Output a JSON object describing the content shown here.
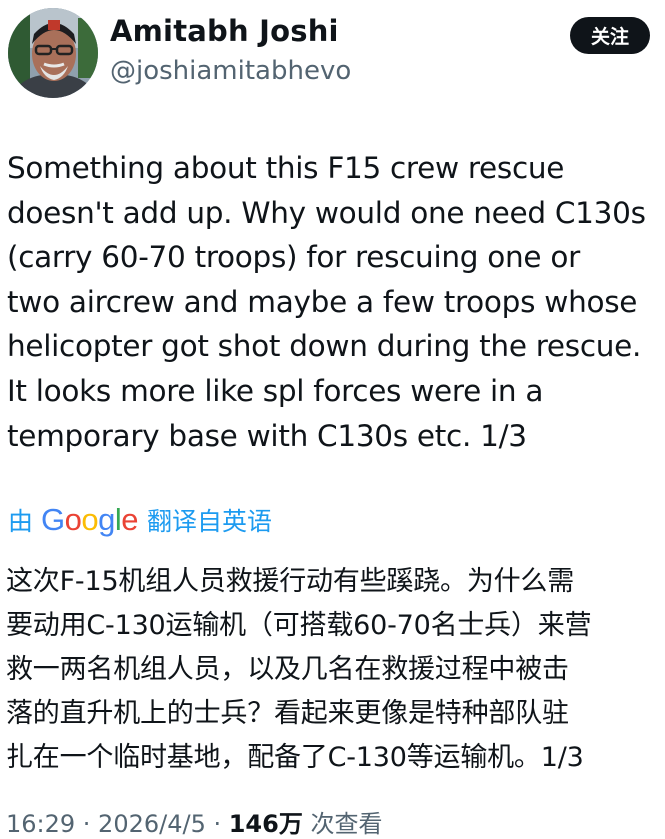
{
  "author": {
    "name": "Amitabh Joshi",
    "handle": "@joshiamitabhevo",
    "follow_label": "关注"
  },
  "tweet": {
    "lines": [
      "Something about this F15 crew rescue",
      "doesn't add up. Why would one need C130s",
      "(carry 60-70 troops) for rescuing one or",
      "two aircrew and maybe a few troops whose",
      "helicopter got shot down during the rescue.",
      "It looks more like spl forces were in a",
      "temporary base with C130s etc. 1/3"
    ]
  },
  "translation_bar": {
    "by_label": "由",
    "logo": {
      "letters": [
        "G",
        "o",
        "o",
        "g",
        "l",
        "e"
      ],
      "colors": [
        "#4285F4",
        "#EA4335",
        "#FBBC05",
        "#4285F4",
        "#34A853",
        "#EA4335"
      ]
    },
    "from_label": "翻译自英语"
  },
  "translation": {
    "lines": [
      "这次F-15机组人员救援行动有些蹊跷。为什么需",
      "要动用C-130运输机（可搭载60-70名士兵）来营",
      "救一两名机组人员，以及几名在救援过程中被击",
      "落的直升机上的士兵？看起来更像是特种部队驻",
      "扎在一个临时基地，配备了C-130等运输机。1/3"
    ]
  },
  "meta": {
    "time": "16:29 · 2026/4/5 · ",
    "views": "146万",
    "views_label": " 次查看"
  }
}
